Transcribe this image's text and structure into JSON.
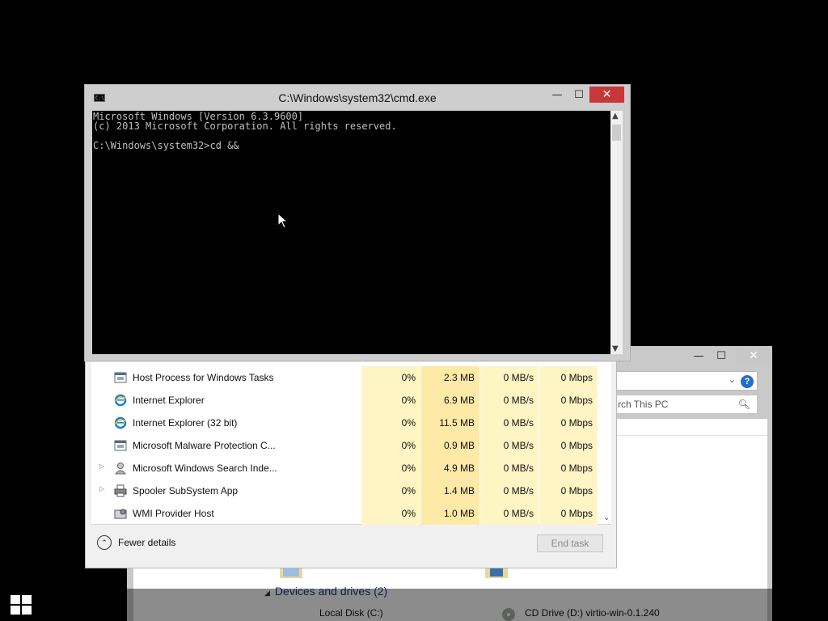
{
  "cmd": {
    "title": "C:\\Windows\\system32\\cmd.exe",
    "icon_text": "C:\\",
    "minimize": "—",
    "maximize": "☐",
    "close": "✕",
    "console_text": "Microsoft Windows [Version 6.3.9600]\n(c) 2013 Microsoft Corporation. All rights reserved.\n\nC:\\Windows\\system32>cd &&"
  },
  "explorer": {
    "minimize": "—",
    "maximize": "☐",
    "close": "✕",
    "address_chevron": "⌄",
    "help": "?",
    "search_placeholder": "rch This PC",
    "group_label": "Devices and drives (2)",
    "drives": [
      "Local Disk (C:)",
      "CD Drive (D:) virtio-win-0.1.240"
    ]
  },
  "taskmgr": {
    "processes": [
      {
        "name": "Host Process for Windows Tasks",
        "icon": "service-window-icon",
        "expandable": false,
        "cpu": "0%",
        "memory": "2.3 MB",
        "disk": "0 MB/s",
        "network": "0 Mbps"
      },
      {
        "name": "Internet Explorer",
        "icon": "internet-explorer-icon",
        "expandable": false,
        "cpu": "0%",
        "memory": "6.9 MB",
        "disk": "0 MB/s",
        "network": "0 Mbps"
      },
      {
        "name": "Internet Explorer (32 bit)",
        "icon": "internet-explorer-icon",
        "expandable": false,
        "cpu": "0%",
        "memory": "11.5 MB",
        "disk": "0 MB/s",
        "network": "0 Mbps"
      },
      {
        "name": "Microsoft Malware Protection C...",
        "icon": "service-window-icon",
        "expandable": false,
        "cpu": "0%",
        "memory": "0.9 MB",
        "disk": "0 MB/s",
        "network": "0 Mbps"
      },
      {
        "name": "Microsoft Windows Search Inde...",
        "icon": "search-indexer-icon",
        "expandable": true,
        "cpu": "0%",
        "memory": "4.9 MB",
        "disk": "0 MB/s",
        "network": "0 Mbps"
      },
      {
        "name": "Spooler SubSystem App",
        "icon": "printer-icon",
        "expandable": true,
        "cpu": "0%",
        "memory": "1.4 MB",
        "disk": "0 MB/s",
        "network": "0 Mbps"
      },
      {
        "name": "WMI Provider Host",
        "icon": "wmi-host-icon",
        "expandable": false,
        "cpu": "0%",
        "memory": "1.0 MB",
        "disk": "0 MB/s",
        "network": "0 Mbps"
      }
    ],
    "fewer_details_label": "Fewer details",
    "end_task_label": "End task"
  }
}
